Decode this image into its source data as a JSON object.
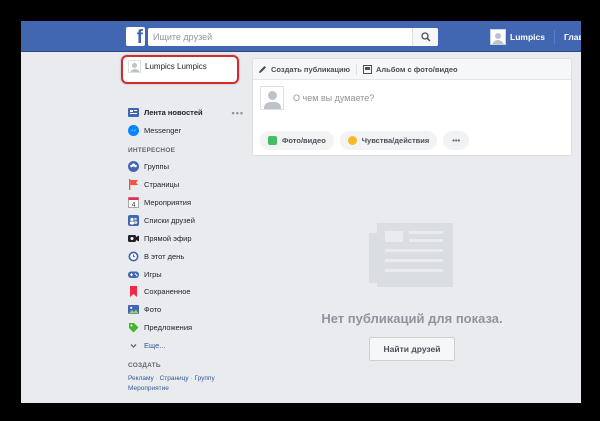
{
  "topbar": {
    "logo_letter": "f",
    "search_placeholder": "Ищите друзей",
    "user_name": "Lumpics",
    "home_label": "Главная"
  },
  "sidebar": {
    "profile_name": "Lumpics Lumpics",
    "main_items": [
      {
        "label": "Лента новостей",
        "icon": "news-feed-icon",
        "active": true
      },
      {
        "label": "Messenger",
        "icon": "messenger-icon"
      }
    ],
    "more_dots": "•••",
    "interesting_header": "ИНТЕРЕСНОЕ",
    "interesting_items": [
      {
        "label": "Группы",
        "icon": "groups-icon"
      },
      {
        "label": "Страницы",
        "icon": "pages-icon"
      },
      {
        "label": "Мероприятия",
        "icon": "events-icon"
      },
      {
        "label": "Списки друзей",
        "icon": "friend-lists-icon"
      },
      {
        "label": "Прямой эфир",
        "icon": "live-video-icon"
      },
      {
        "label": "В этот день",
        "icon": "on-this-day-icon"
      },
      {
        "label": "Игры",
        "icon": "games-icon"
      },
      {
        "label": "Сохраненное",
        "icon": "saved-icon"
      },
      {
        "label": "Фото",
        "icon": "photos-icon"
      },
      {
        "label": "Предложения",
        "icon": "offers-icon"
      },
      {
        "label": "Еще...",
        "icon": "chevron-down-icon"
      }
    ],
    "create_header": "СОЗДАТЬ",
    "create_links": [
      "Рекламу",
      "Страницу",
      "Группу",
      "Мероприятие"
    ],
    "create_separator": " · ",
    "event_day": "4"
  },
  "composer": {
    "tab_create": "Создать публикацию",
    "tab_album": "Альбом с фото/видео",
    "prompt": "О чем вы думаете?",
    "action_photo": "Фото/видео",
    "action_feeling": "Чувства/действия",
    "action_more": "•••"
  },
  "feed": {
    "empty_text": "Нет публикаций для показа.",
    "find_friends_label": "Найти друзей"
  },
  "colors": {
    "brand_blue": "#4267b2",
    "highlight_red": "#d42c2c",
    "background": "#e9ebee"
  }
}
